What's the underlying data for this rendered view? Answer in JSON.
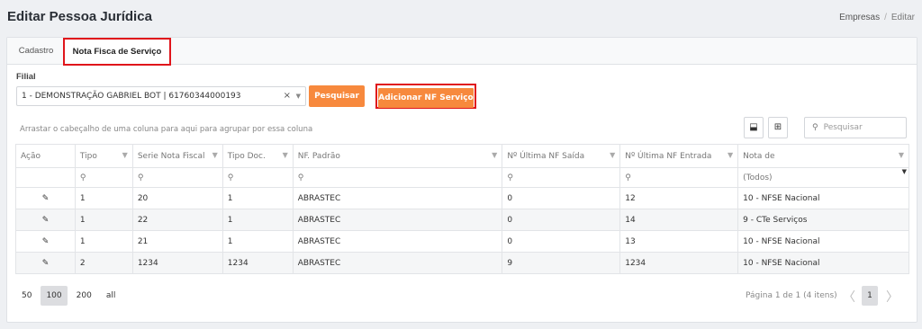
{
  "page": {
    "title": "Editar Pessoa Jurídica"
  },
  "breadcrumb": {
    "parent": "Empresas",
    "separator": "/",
    "current": "Editar"
  },
  "tabs": [
    {
      "label": "Cadastro",
      "active": false
    },
    {
      "label": "Nota Fisca de Serviço",
      "active": true
    }
  ],
  "filial": {
    "label": "Filial",
    "selected": "1 - DEMONSTRAÇÃO GABRIEL BOT | 61760344000193",
    "clear_glyph": "×",
    "caret_glyph": "▼"
  },
  "buttons": {
    "pesquisar": "Pesquisar",
    "adicionar": "Adicionar NF Serviço"
  },
  "grid": {
    "group_hint": "Arrastar o cabeçalho de uma coluna para aqui para agrupar por essa coluna",
    "search_placeholder": "Pesquisar",
    "search_icon_glyph": "⚲",
    "export_icon_glyph": "⬓",
    "chooser_icon_glyph": "⊞",
    "filter_icon_glyph": "▼",
    "columns": [
      "Ação",
      "Tipo",
      "Serie Nota Fiscal",
      "Tipo Doc.",
      "NF. Padrão",
      "Nº Última NF Saída",
      "Nº Última NF Entrada",
      "Nota de"
    ],
    "filter_search_glyph": "⚲",
    "filter_todos": "(Todos)",
    "edit_icon_glyph": "✎",
    "rows": [
      {
        "tipo": "1",
        "serie": "20",
        "tipo_doc": "1",
        "nf_padrao": "ABRASTEC",
        "ultima_saida": "0",
        "ultima_entrada": "12",
        "nota_de": "10 - NFSE Nacional"
      },
      {
        "tipo": "1",
        "serie": "22",
        "tipo_doc": "1",
        "nf_padrao": "ABRASTEC",
        "ultima_saida": "0",
        "ultima_entrada": "14",
        "nota_de": "9 - CTe Serviços"
      },
      {
        "tipo": "1",
        "serie": "21",
        "tipo_doc": "1",
        "nf_padrao": "ABRASTEC",
        "ultima_saida": "0",
        "ultima_entrada": "13",
        "nota_de": "10 - NFSE Nacional"
      },
      {
        "tipo": "2",
        "serie": "1234",
        "tipo_doc": "1234",
        "nf_padrao": "ABRASTEC",
        "ultima_saida": "9",
        "ultima_entrada": "1234",
        "nota_de": "10 - NFSE Nacional"
      }
    ]
  },
  "pager": {
    "sizes": [
      "50",
      "100",
      "200",
      "all"
    ],
    "active_size": "100",
    "info": "Página 1 de 1 (4 itens)",
    "prev_glyph": "〈",
    "current_page": "1",
    "next_glyph": "〉"
  },
  "colors": {
    "accent": "#f7893d",
    "highlight_border": "#e0151b",
    "edit_icon": "#5a57a8"
  }
}
